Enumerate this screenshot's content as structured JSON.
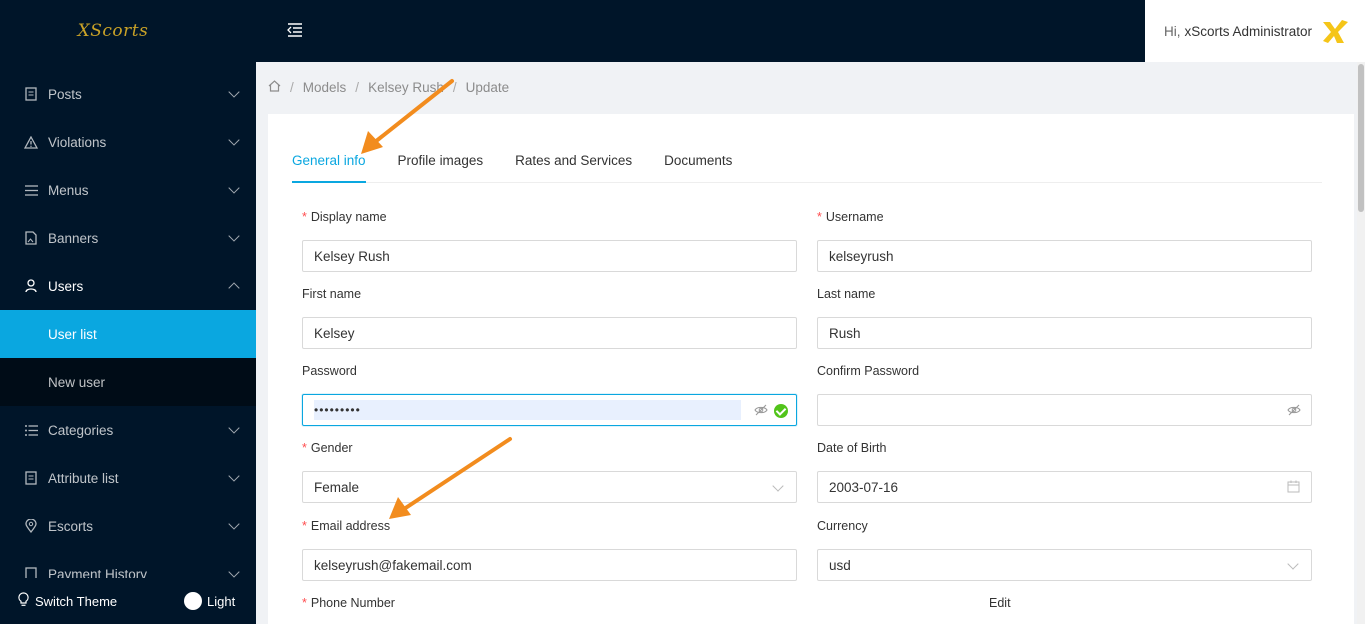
{
  "app": {
    "logo_text": "XScorts"
  },
  "sidebar": {
    "items": [
      {
        "label": "Posts",
        "icon": "file-icon"
      },
      {
        "label": "Violations",
        "icon": "warning-icon"
      },
      {
        "label": "Menus",
        "icon": "menu-icon"
      },
      {
        "label": "Banners",
        "icon": "file-image-icon"
      },
      {
        "label": "Users",
        "icon": "user-icon"
      },
      {
        "label": "Categories",
        "icon": "list-icon"
      },
      {
        "label": "Attribute list",
        "icon": "file-icon"
      },
      {
        "label": "Escorts",
        "icon": "location-icon"
      },
      {
        "label": "Payment History",
        "icon": "file-icon"
      }
    ],
    "users_submenu": [
      {
        "label": "User list"
      },
      {
        "label": "New user"
      }
    ],
    "footer": {
      "switch_theme": "Switch Theme",
      "theme_value": "Light"
    }
  },
  "header": {
    "greeting": "Hi,",
    "user_name": "xScorts Administrator"
  },
  "breadcrumb": {
    "items": [
      "Models",
      "Kelsey Rush",
      "Update"
    ]
  },
  "tabs": [
    {
      "label": "General info"
    },
    {
      "label": "Profile images"
    },
    {
      "label": "Rates and Services"
    },
    {
      "label": "Documents"
    }
  ],
  "form": {
    "display_name": {
      "label": "Display name",
      "value": "Kelsey Rush"
    },
    "username": {
      "label": "Username",
      "value": "kelseyrush"
    },
    "first_name": {
      "label": "First name",
      "value": "Kelsey"
    },
    "last_name": {
      "label": "Last name",
      "value": "Rush"
    },
    "password": {
      "label": "Password",
      "value": "•••••••••"
    },
    "confirm_password": {
      "label": "Confirm Password",
      "value": ""
    },
    "gender": {
      "label": "Gender",
      "value": "Female"
    },
    "date_of_birth": {
      "label": "Date of Birth",
      "value": "2003-07-16"
    },
    "email": {
      "label": "Email address",
      "value": "kelseyrush@fakemail.com"
    },
    "currency": {
      "label": "Currency",
      "value": "usd"
    },
    "phone": {
      "label": "Phone Number"
    },
    "edit": {
      "label": "Edit"
    }
  },
  "colors": {
    "accent": "#0aa7e0",
    "sidebar_bg": "#001529",
    "annotation_arrow": "#f28c1e",
    "required": "#ff4d4f"
  }
}
